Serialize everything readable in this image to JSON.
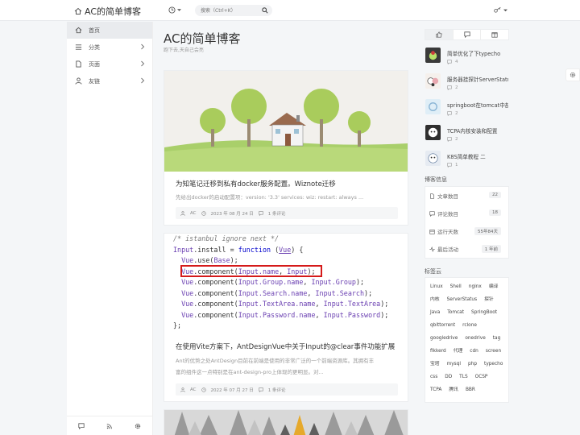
{
  "header": {
    "site_title": "AC的简单博客",
    "search_placeholder": "搜索（Ctrl+K）"
  },
  "sidebar": {
    "items": [
      {
        "label": "首页",
        "icon": "home-icon",
        "active": true
      },
      {
        "label": "分类",
        "icon": "list-icon",
        "has_arrow": true
      },
      {
        "label": "页面",
        "icon": "file-icon",
        "has_arrow": true
      },
      {
        "label": "友链",
        "icon": "user-icon",
        "has_arrow": true
      }
    ],
    "footer_icons": [
      "chat-icon",
      "rss-icon",
      "settings-icon"
    ]
  },
  "main": {
    "title": "AC的简单博客",
    "subtitle": "跑下去,天自己会亮",
    "posts": [
      {
        "title": "为知笔记迁移到私有docker服务配置。Wiznote迁移",
        "excerpt": "先给出docker的启动配置项：version: '3.3' services: wiz: restart: always ...",
        "author": "AC",
        "date": "2023 年 08 月 24 日",
        "comments": "1 条评论"
      },
      {
        "title": "在使用Vite方案下，AntDesignVue中关于Input的@clear事件功能扩展",
        "excerpt_line1": "Ant的优势之处AntDesign目前在前端是使用的非常广泛的一个前端资源库。其拥有丰",
        "excerpt_line2": "富的组件这一点特别是在ant-design-pro上体现的更明显。对...",
        "author": "AC",
        "date": "2022 年 07 月 27 日",
        "comments": "1 条评论",
        "code": {
          "l1": "/* istanbul ignore next */",
          "l2a": "Input",
          "l2b": ".install = ",
          "l2c": "function",
          "l2d": " (",
          "l2e": "Vue",
          "l2f": ") {",
          "l3a": "Vue",
          "l3b": ".use(",
          "l3c": "Base",
          "l3d": ");",
          "l4a": "Vue",
          "l4b": ".component(",
          "l4c": "Input.name",
          "l4d": ", ",
          "l4e": "Input",
          "l4f": ");",
          "l5a": "Vue",
          "l5b": ".component(",
          "l5c": "Input.Group.name",
          "l5d": ", ",
          "l5e": "Input.Group",
          "l5f": ");",
          "l6a": "Vue",
          "l6b": ".component(",
          "l6c": "Input.Search.name",
          "l6d": ", ",
          "l6e": "Input.Search",
          "l6f": ");",
          "l7a": "Vue",
          "l7b": ".component(",
          "l7c": "Input.TextArea.name",
          "l7d": ", ",
          "l7e": "Input.TextArea",
          "l7f": ");",
          "l8a": "Vue",
          "l8b": ".component(",
          "l8c": "Input.Password.name",
          "l8d": ", ",
          "l8e": "Input.Password",
          "l8f": ");",
          "l9": "};"
        }
      }
    ]
  },
  "right": {
    "tab_icons": [
      "thumb-up-icon",
      "comment-icon",
      "gift-icon"
    ],
    "recent_posts": [
      {
        "title": "简单优化了下typecho",
        "count": "4"
      },
      {
        "title": "服务器挂探针ServerStatus",
        "count": "2"
      },
      {
        "title": "springboot在tomcat中部署",
        "count": "2"
      },
      {
        "title": "TCPA内核安装和配置",
        "count": "2"
      },
      {
        "title": "K8S简单教程 二",
        "count": "1"
      }
    ],
    "stats_title": "博客信息",
    "stats": [
      {
        "label": "文章数目",
        "value": "22"
      },
      {
        "label": "评论数目",
        "value": "18"
      },
      {
        "label": "运行天数",
        "value": "55年84天"
      },
      {
        "label": "最后活动",
        "value": "1 年前"
      }
    ],
    "tags_title": "标签云",
    "tags": [
      "Linux",
      "Shell",
      "nginx",
      "编译",
      "内核",
      "ServerStatus",
      "探针",
      "Java",
      "Tomcat",
      "SpringBoot",
      "qbittorrent",
      "rclone",
      "googledrive",
      "onedrive",
      "tag",
      "fikkerd",
      "代理",
      "cdn",
      "screen",
      "宝塔",
      "mysql",
      "php",
      "typecho",
      "css",
      "DD",
      "TLS",
      "OCSP",
      "TCPA",
      "腾讯",
      "BBR"
    ]
  },
  "colors": {
    "accent_red": "#d51a1a",
    "code_keyword": "#0000cc",
    "code_object": "#6a3fb1"
  }
}
